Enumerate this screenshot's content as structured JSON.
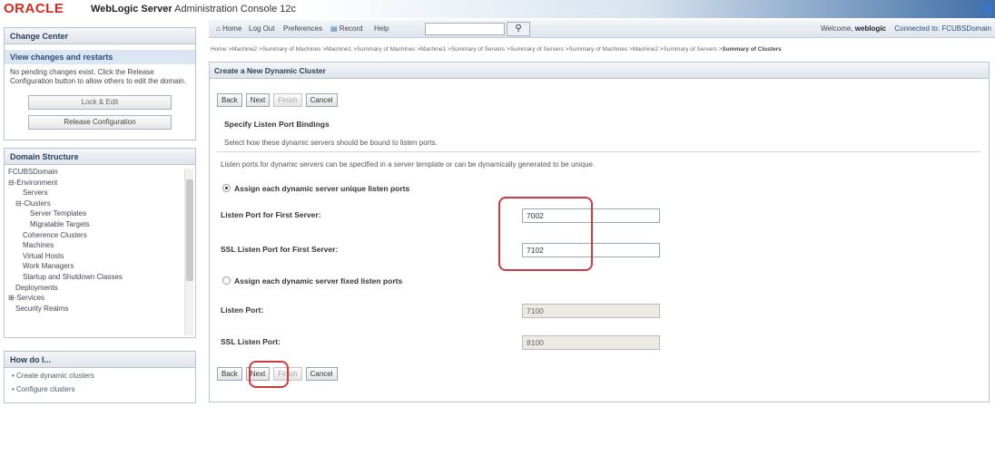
{
  "banner": {
    "logo": "ORACLE",
    "product_bold": "WebLogic Server",
    "product_rest": "Administration Console 12c"
  },
  "change_center": {
    "title": "Change Center",
    "subtitle": "View changes and restarts",
    "message": "No pending changes exist. Click the Release Configuration button to allow others to edit the domain.",
    "lock_label": "Lock & Edit",
    "release_label": "Release Configuration"
  },
  "domain_structure": {
    "title": "Domain Structure",
    "items": [
      {
        "label": "FCUBSDomain",
        "indent": 0
      },
      {
        "label": "⊟-Environment",
        "indent": 0
      },
      {
        "label": "Servers",
        "indent": 2
      },
      {
        "label": "⊟-Clusters",
        "indent": 1
      },
      {
        "label": "Server Templates",
        "indent": 3
      },
      {
        "label": "Migratable Targets",
        "indent": 3
      },
      {
        "label": "Coherence Clusters",
        "indent": 2
      },
      {
        "label": "Machines",
        "indent": 2
      },
      {
        "label": "Virtual Hosts",
        "indent": 2
      },
      {
        "label": "Work Managers",
        "indent": 2
      },
      {
        "label": "Startup and Shutdown Classes",
        "indent": 2
      },
      {
        "label": "Deployments",
        "indent": 1
      },
      {
        "label": "⊞-Services",
        "indent": 0
      },
      {
        "label": "Security Realms",
        "indent": 1
      }
    ]
  },
  "how_do_i": {
    "title": "How do I...",
    "items": [
      "Create dynamic clusters",
      "Configure clusters"
    ]
  },
  "toolbar": {
    "home": "Home",
    "logout": "Log Out",
    "preferences": "Preferences",
    "record": "Record",
    "help": "Help",
    "search_value": "",
    "welcome_prefix": "Welcome,",
    "user": "weblogic",
    "connected": "Connected to: FCUBSDomain"
  },
  "breadcrumb": {
    "trail": "Home >Machine2 >Summary of Machines >Machine1 >Summary of Machines >Machine1 >Summary of Servers >Summary of Servers >Summary of Machines >Machine2 >Summary of Servers >",
    "current": "Summary of Clusters"
  },
  "main": {
    "title": "Create a New Dynamic Cluster",
    "buttons": {
      "back": "Back",
      "next": "Next",
      "finish": "Finish",
      "cancel": "Cancel"
    },
    "section_title": "Specify Listen Port Bindings",
    "section_desc": "Select how these dynamic servers should be bound to listen ports.",
    "intro": "Listen ports for dynamic servers can be specified in a server template or can be dynamically generated to be unique.",
    "option_unique": "Assign each dynamic server unique listen ports",
    "listen_port_first_label": "Listen Port for First Server:",
    "listen_port_first_value": "7002",
    "ssl_port_first_label": "SSL Listen Port for First Server:",
    "ssl_port_first_value": "7102",
    "option_fixed": "Assign each dynamic server fixed listen ports",
    "listen_port_label": "Listen Port:",
    "listen_port_value": "7100",
    "ssl_port_label": "SSL Listen Port:",
    "ssl_port_value": "8100"
  },
  "colors": {
    "accent_red": "#d0393e",
    "oracle_red": "#d52b1e",
    "panel_blue": "#2a3e58"
  }
}
